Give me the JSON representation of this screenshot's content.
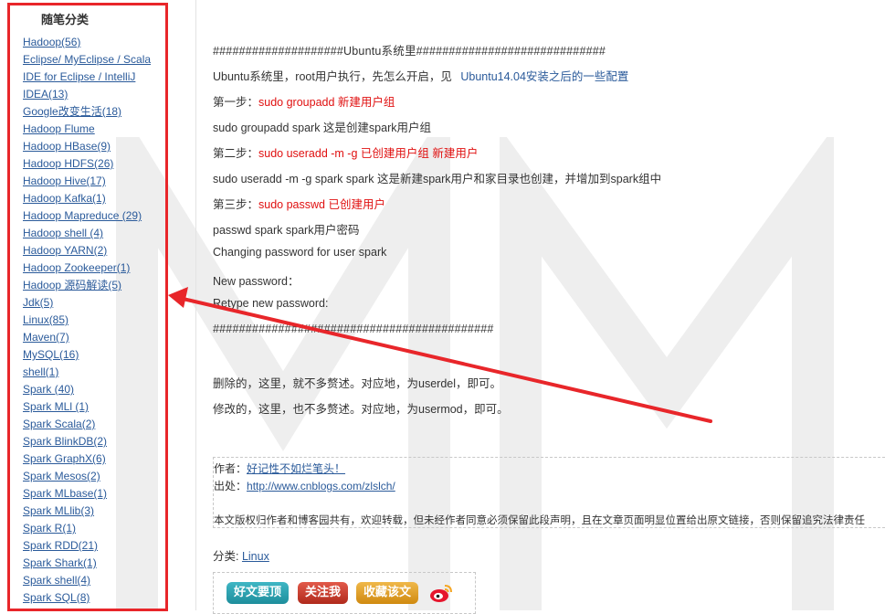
{
  "sidebar": {
    "title": "随笔分类",
    "categories": [
      "Hadoop(56)",
      "Eclipse/ MyEclipse / Scala",
      "IDE for Eclipse / IntelliJ",
      "IDEA(13)",
      "Google改变生活(18)",
      "Hadoop Flume",
      "Hadoop HBase(9)",
      "Hadoop HDFS(26)",
      "Hadoop Hive(17)",
      "Hadoop Kafka(1)",
      "Hadoop Mapreduce (29)",
      "Hadoop shell (4)",
      "Hadoop YARN(2)",
      "Hadoop Zookeeper(1)",
      "Hadoop 源码解读(5)",
      "Jdk(5)",
      "Linux(85)",
      "Maven(7)",
      "MySQL(16)",
      "shell(1)",
      "Spark (40)",
      "Spark MLl (1)",
      "Spark Scala(2)",
      "Spark BlinkDB(2)",
      "Spark GraphX(6)",
      "Spark Mesos(2)",
      "Spark MLbase(1)",
      "Spark MLlib(3)",
      "Spark R(1)",
      "Spark RDD(21)",
      "Spark Shark(1)",
      "Spark shell(4)",
      "Spark SQL(8)"
    ]
  },
  "post": {
    "header_hash": "####################Ubuntu系统里#############################",
    "intro_text": "Ubuntu系统里，root用户执行，先怎么开启，见",
    "intro_link": "Ubuntu14.04安装之后的一些配置",
    "step1_label": "第一步：",
    "step1_cmd": "sudo groupadd  新建用户组",
    "step1_example": "sudo  groupadd spark   这是创建spark用户组",
    "step2_label": "第二步：",
    "step2_cmd": "sudo useradd  -m -g   已创建用户组    新建用户",
    "step2_example": "sudo  useradd  -m -g spark  spark   这是新建spark用户和家目录也创建，并增加到spark组中",
    "step3_label": "第三步：",
    "step3_cmd": "sudo passwd  已创建用户",
    "step3_example": "passwd spark    spark用户密码",
    "changing": "Changing password  for user spark",
    "new_pw": "New password：",
    "retype_pw": "Retype new password:",
    "footer_hash": "###########################################",
    "delete_note": "删除的，这里，就不多赘述。对应地，为userdel，即可。",
    "modify_note": "修改的，这里，也不多赘述。对应地，为usermod，即可。"
  },
  "signature": {
    "author_label": "作者：",
    "author_name": "好记性不如烂笔头！",
    "source_label": "出处：",
    "source_url": "http://www.cnblogs.com/zlslch/",
    "copyright": "本文版权归作者和博客园共有，欢迎转载，但未经作者同意必须保留此段声明，且在文章页面明显位置给出原文链接，否则保留追究法律责任"
  },
  "category_line": {
    "label": "分类: ",
    "value": "Linux"
  },
  "buttons": {
    "good": "好文要顶",
    "follow": "关注我",
    "favorite": "收藏该文"
  },
  "icons": {
    "weibo": "weibo-share-icon"
  },
  "colors": {
    "highlight_border": "#e8262a",
    "link": "#2a5a9a",
    "command_red": "#e01010"
  }
}
